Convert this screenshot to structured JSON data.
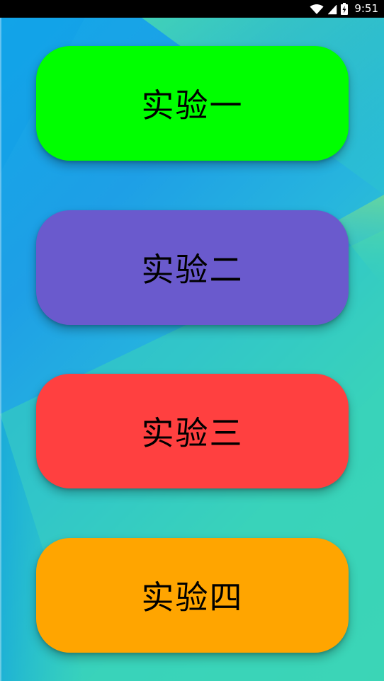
{
  "status_bar": {
    "time": "9:51",
    "icons": [
      "wifi-icon",
      "cell-signal-icon",
      "battery-charging-icon"
    ]
  },
  "buttons": [
    {
      "label": "实验一",
      "color": "#00ff00"
    },
    {
      "label": "实验二",
      "color": "#6a5acd"
    },
    {
      "label": "实验三",
      "color": "#ff4040"
    },
    {
      "label": "实验四",
      "color": "#ffa500"
    }
  ]
}
